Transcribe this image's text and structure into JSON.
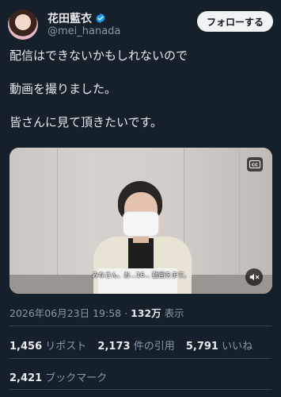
{
  "user": {
    "display_name": "花田藍衣",
    "handle": "@mei_hanada",
    "follow_label": "フォローする"
  },
  "tweet": {
    "lines": [
      "配信はできないかもしれないので",
      "動画を撮りました。",
      "皆さんに見て頂きたいです。"
    ]
  },
  "video": {
    "subtitle": "みなさん、お...16... 動画をます。"
  },
  "meta": {
    "timestamp": "2026年06月23日 19:58",
    "separator": "·",
    "views_count": "132万",
    "views_label": "表示"
  },
  "stats": {
    "reposts": {
      "count": "1,456",
      "label": "リポスト"
    },
    "quotes": {
      "count": "2,173",
      "label": "件の引用"
    },
    "likes": {
      "count": "5,791",
      "label": "いいね"
    },
    "bookmarks": {
      "count": "2,421",
      "label": "ブックマーク"
    }
  },
  "colors": {
    "background": "#15202b",
    "verified": "#1d9bf0",
    "muted_text": "#8b98a5"
  }
}
